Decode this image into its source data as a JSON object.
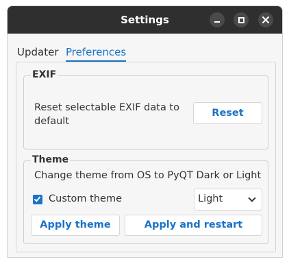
{
  "window": {
    "title": "Settings"
  },
  "tabs": [
    {
      "label": "Updater",
      "active": false
    },
    {
      "label": "Preferences",
      "active": true
    }
  ],
  "exif": {
    "group_title": "EXIF",
    "description": "Reset selectable EXIF data to default",
    "reset_label": "Reset"
  },
  "theme": {
    "group_title": "Theme",
    "description": "Change theme from OS to PyQT Dark or Light",
    "custom_theme_label": "Custom theme",
    "custom_theme_checked": true,
    "selected": "Light",
    "apply_label": "Apply theme",
    "apply_restart_label": "Apply and restart"
  },
  "colors": {
    "accent": "#1a73c7",
    "titlebar": "#2f2f2f"
  },
  "icons": {
    "minimize": "minimize-icon",
    "maximize": "maximize-icon",
    "close": "close-icon",
    "dropdown": "chevron-down-icon",
    "checkbox": "checkmark-icon"
  }
}
